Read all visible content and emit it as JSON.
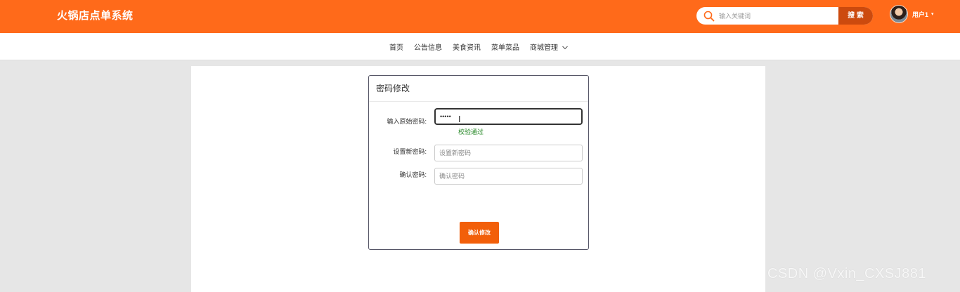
{
  "header": {
    "site_title": "火锅店点单系统",
    "search_placeholder": "输入关键词",
    "search_button": "搜 索",
    "user_name": "用户1",
    "user_caret": "▾",
    "bg_color": "#ff6a1a",
    "search_button_color": "#cc4a0e"
  },
  "nav": {
    "items": [
      {
        "label": "首页"
      },
      {
        "label": "公告信息"
      },
      {
        "label": "美食资讯"
      },
      {
        "label": "菜单菜品"
      },
      {
        "label": "商城管理"
      }
    ],
    "dropdown_icon": "chevron-down-icon"
  },
  "form": {
    "title": "密码修改",
    "old_password_label": "输入原始密码:",
    "old_password_value": "•••••",
    "validation_message": "校验通过",
    "new_password_label": "设置新密码:",
    "new_password_placeholder": "设置新密码",
    "confirm_password_label": "确认密码:",
    "confirm_password_placeholder": "确认密码",
    "submit_label": "确认修改",
    "submit_color": "#f25f0a",
    "validation_color": "#2a8a2a"
  },
  "watermark": "CSDN @Vxin_CXSJ881"
}
